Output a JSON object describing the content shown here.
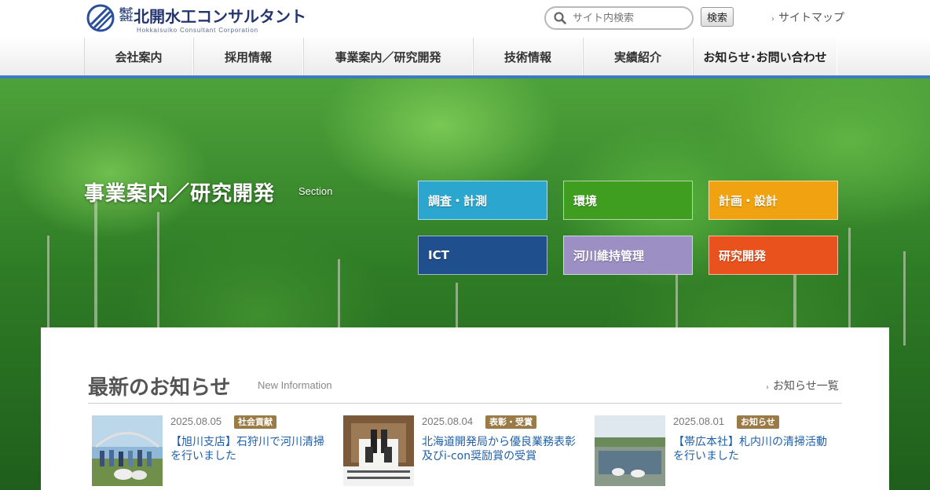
{
  "header": {
    "logo_kaisha": "株式会社",
    "logo_name": "北開水工コンサルタント",
    "logo_sub": "Hokkaisuiko Consultant Corporation",
    "search_placeholder": "サイト内検索",
    "search_button": "検索",
    "sitemap": "サイトマップ",
    "sitemap_arrow": "›"
  },
  "nav": {
    "items": [
      {
        "label": "会社案内"
      },
      {
        "label": "採用情報"
      },
      {
        "label": "事業案内／研究開発"
      },
      {
        "label": "技術情報"
      },
      {
        "label": "実績紹介"
      },
      {
        "label": "お知らせ･お問い合わせ"
      }
    ]
  },
  "hero": {
    "title": "事業案内／研究開発",
    "sub": "Section",
    "tiles": [
      {
        "label": "調査・計測",
        "color": "#2aa6cf"
      },
      {
        "label": "環境",
        "color": "#3f9d20"
      },
      {
        "label": "計画・設計",
        "color": "#f0a210"
      },
      {
        "label": "ICT",
        "color": "#1f4f8c"
      },
      {
        "label": "河川維持管理",
        "color": "#9b8fc4"
      },
      {
        "label": "研究開発",
        "color": "#e9521c"
      }
    ]
  },
  "news": {
    "title": "最新のお知らせ",
    "sub": "New Information",
    "all_link": "お知らせ一覧",
    "all_arrow": "›",
    "items": [
      {
        "date": "2025.08.05",
        "badge": "社会貢献",
        "text": "【旭川支店】石狩川で河川清掃を行いました"
      },
      {
        "date": "2025.08.04",
        "badge": "表彰・受賞",
        "text": "北海道開発局から優良業務表彰及びi-con奨励賞の受賞"
      },
      {
        "date": "2025.08.01",
        "badge": "お知らせ",
        "text": "【帯広本社】札内川の清掃活動を行いました"
      }
    ]
  },
  "colors": {
    "nav_accent": "#3c7bbf",
    "badge": "#9a7a46",
    "link": "#1f5fa6"
  }
}
